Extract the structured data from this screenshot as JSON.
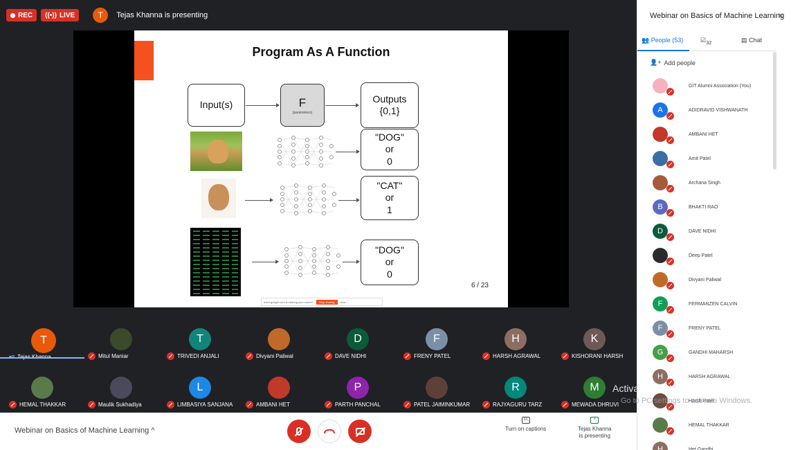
{
  "topbar": {
    "rec_label": "REC",
    "live_label": "LIVE",
    "presenter_initial": "T",
    "presenting_text": "Tejas Khanna is presenting"
  },
  "slide": {
    "title": "Program As A Function",
    "input_label": "Input(s)",
    "f_label": "F",
    "f_sub": "(parameters)",
    "outputs_label_1": "Outputs",
    "outputs_label_2": "{0,1}",
    "row1_label_1": "\"DOG\"",
    "row1_label_2": "or",
    "row1_label_3": "0",
    "row2_label_1": "\"CAT\"",
    "row2_label_2": "or",
    "row2_label_3": "1",
    "row3_label_1": "\"DOG\"",
    "row3_label_2": "or",
    "row3_label_3": "0",
    "page": "6 / 23",
    "share_notice": "meet.google.com is sharing your screen.",
    "stop_sharing": "Stop sharing",
    "hide": "Hide"
  },
  "tiles": [
    {
      "name": "Tejas Khanna",
      "initial": "T",
      "color": "#e8590c",
      "muted": false,
      "photo": false
    },
    {
      "name": "Mitul Maniar",
      "initial": "",
      "color": "#3a4a2a",
      "muted": true,
      "photo": true
    },
    {
      "name": "TRIVEDI ANJALI",
      "initial": "T",
      "color": "#12857a",
      "muted": true,
      "photo": false
    },
    {
      "name": "Divyani Paliwal",
      "initial": "",
      "color": "#c06a2a",
      "muted": true,
      "photo": true
    },
    {
      "name": "DAVE NIDHI",
      "initial": "D",
      "color": "#0b5a3a",
      "muted": true,
      "photo": false
    },
    {
      "name": "FRENY PATEL",
      "initial": "F",
      "color": "#7b8fa6",
      "muted": true,
      "photo": false
    },
    {
      "name": "HARSH AGRAWAL",
      "initial": "H",
      "color": "#8d6e63",
      "muted": true,
      "photo": false
    },
    {
      "name": "KISHORANI HARSH",
      "initial": "K",
      "color": "#6d5a56",
      "muted": true,
      "photo": false
    },
    {
      "name": "HEMAL THAKKAR",
      "initial": "",
      "color": "#5a7a4a",
      "muted": true,
      "photo": true
    },
    {
      "name": "Maulik Sukhadiya",
      "initial": "",
      "color": "#4a4a5a",
      "muted": true,
      "photo": true
    },
    {
      "name": "LIMBASIYA SANJANA",
      "initial": "L",
      "color": "#1e88e5",
      "muted": true,
      "photo": false
    },
    {
      "name": "AMBANI HET",
      "initial": "",
      "color": "#c0392b",
      "muted": true,
      "photo": true
    },
    {
      "name": "PARTH PANCHAL",
      "initial": "P",
      "color": "#8e24aa",
      "muted": true,
      "photo": false
    },
    {
      "name": "PATEL JAIMINKUMAR",
      "initial": "",
      "color": "#5d4037",
      "muted": true,
      "photo": true
    },
    {
      "name": "RAJYAGURU TARZ",
      "initial": "R",
      "color": "#00897b",
      "muted": true,
      "photo": false
    },
    {
      "name": "MEWADA DHRUVI",
      "initial": "M",
      "color": "#2e7d32",
      "muted": true,
      "photo": false
    }
  ],
  "watermark": {
    "line1": "Activate Windows",
    "line2": "Go to PC settings to activate Windows."
  },
  "bottombar": {
    "meeting_title": "Webinar on Basics of Machine Learning",
    "captions_label": "Turn on captions",
    "presenting_label_1": "Tejas Khanna",
    "presenting_label_2": "is presenting"
  },
  "panel": {
    "title": "Webinar on Basics of Machine Learning",
    "close": "×",
    "tab_people": "People (53)",
    "tab_polls_count": "32",
    "tab_chat": "Chat",
    "add_people": "Add people",
    "people": [
      {
        "name": "GIT Alumni Association (You)",
        "initial": "",
        "color": "#f5b1c0"
      },
      {
        "name": "ADIDRAVID VISHWANATH",
        "initial": "A",
        "color": "#1a73e8"
      },
      {
        "name": "AMBANI HET",
        "initial": "",
        "color": "#c0392b"
      },
      {
        "name": "Amit Patel",
        "initial": "",
        "color": "#3a6ea5"
      },
      {
        "name": "Archana Singh",
        "initial": "",
        "color": "#a65a3a"
      },
      {
        "name": "BHAKTI RAO",
        "initial": "B",
        "color": "#5c6bc0"
      },
      {
        "name": "DAVE NIDHI",
        "initial": "D",
        "color": "#0b5a3a"
      },
      {
        "name": "Deep Patel",
        "initial": "",
        "color": "#2b2b2b"
      },
      {
        "name": "Divyani Paliwal",
        "initial": "",
        "color": "#c06a2a"
      },
      {
        "name": "FERMANZEN CALVIN",
        "initial": "F",
        "color": "#0f9d58"
      },
      {
        "name": "FRENY PATEL",
        "initial": "F",
        "color": "#7b8fa6"
      },
      {
        "name": "GANDHI MAHARSH",
        "initial": "G",
        "color": "#43a047"
      },
      {
        "name": "HARSH AGRAWAL",
        "initial": "H",
        "color": "#8d6e63"
      },
      {
        "name": "Harsh Patel",
        "initial": "",
        "color": "#6d4c41"
      },
      {
        "name": "HEMAL THAKKAR",
        "initial": "",
        "color": "#5a7a4a"
      },
      {
        "name": "Het Gandhi",
        "initial": "H",
        "color": "#8d6e63"
      }
    ]
  }
}
